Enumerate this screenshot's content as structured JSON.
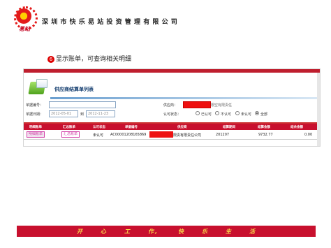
{
  "header": {
    "logo_text": "易站",
    "company": "深圳市快乐易站投资管理有限公司"
  },
  "step": {
    "number": "6",
    "text": "显示账单，可查询相关明细"
  },
  "panel": {
    "title": "供应商结算单列表",
    "form": {
      "bill_no_label": "单据编号：",
      "bill_no_value": "",
      "supplier_label": "供应商：",
      "supplier_value": "",
      "supplier_hint": "限空有限责任",
      "bill_date_label": "单据日期：",
      "date_from": "2012-05-01",
      "date_to": "2012-11-23",
      "date_sep": "到",
      "status_label": "认可状态：",
      "status_options": [
        "已认可",
        "不认可",
        "未认可",
        "全部"
      ],
      "status_selected": "全部"
    },
    "table": {
      "headers": [
        "明细账单",
        "汇总账单",
        "认可状态",
        "单据编号",
        "供应商",
        "结算期间",
        "结算金额",
        "结余金额"
      ],
      "rows": [
        {
          "detail": "明细账单",
          "summary": "汇总账单",
          "status": "未认可",
          "bill_no": "AC00001208165869",
          "supplier": "限责有限责任公司",
          "period": "201207",
          "amount": "9732.77",
          "balance": "0.00"
        }
      ]
    }
  },
  "footer": {
    "slogan": [
      "开",
      "心",
      "工",
      "作，",
      "快",
      "乐",
      "生",
      "活"
    ]
  },
  "colors": {
    "brand_red": "#c8102e",
    "footer_text": "#f7d54a"
  }
}
